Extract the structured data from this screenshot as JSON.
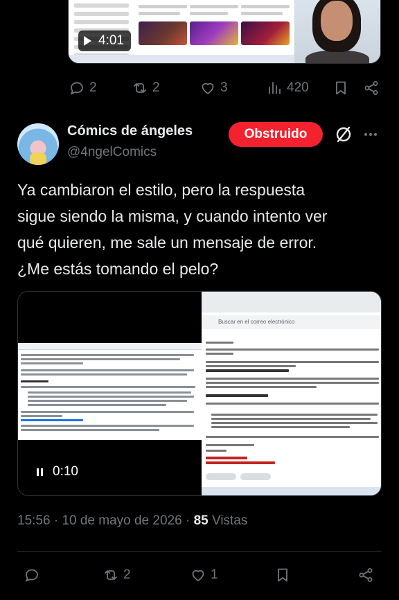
{
  "previous_tweet": {
    "video_duration": "4:01",
    "stats": {
      "replies": "2",
      "reposts": "2",
      "likes": "3",
      "views": "420"
    }
  },
  "tweet": {
    "author_name": "Cómics de ángeles",
    "author_handle": "@4ngelComics",
    "blocked_label": "Obstruido",
    "text": "Ya cambiaron el estilo, pero la respuesta\nsigue siendo la misma, y cuando intento ver\nqué quieren, me sale un mensaje de error.\n¿Me estás tomando el pelo?",
    "video_time": "0:10",
    "video_email_search_placeholder": "Buscar en el correo electrónico",
    "time": "15:56",
    "date": "10 de mayo de 2026",
    "views_count": "85",
    "views_label": "Vistas",
    "stats": {
      "reposts": "2",
      "likes": "1"
    }
  },
  "colors": {
    "background": "#000000",
    "text": "#e7e9ea",
    "muted": "#71767b",
    "blocked_button": "#f4212e",
    "divider": "#2f3336"
  },
  "icons": [
    "reply-icon",
    "repost-icon",
    "like-icon",
    "views-icon",
    "bookmark-icon",
    "share-icon",
    "grok-icon",
    "more-icon",
    "play-icon",
    "pause-icon"
  ]
}
